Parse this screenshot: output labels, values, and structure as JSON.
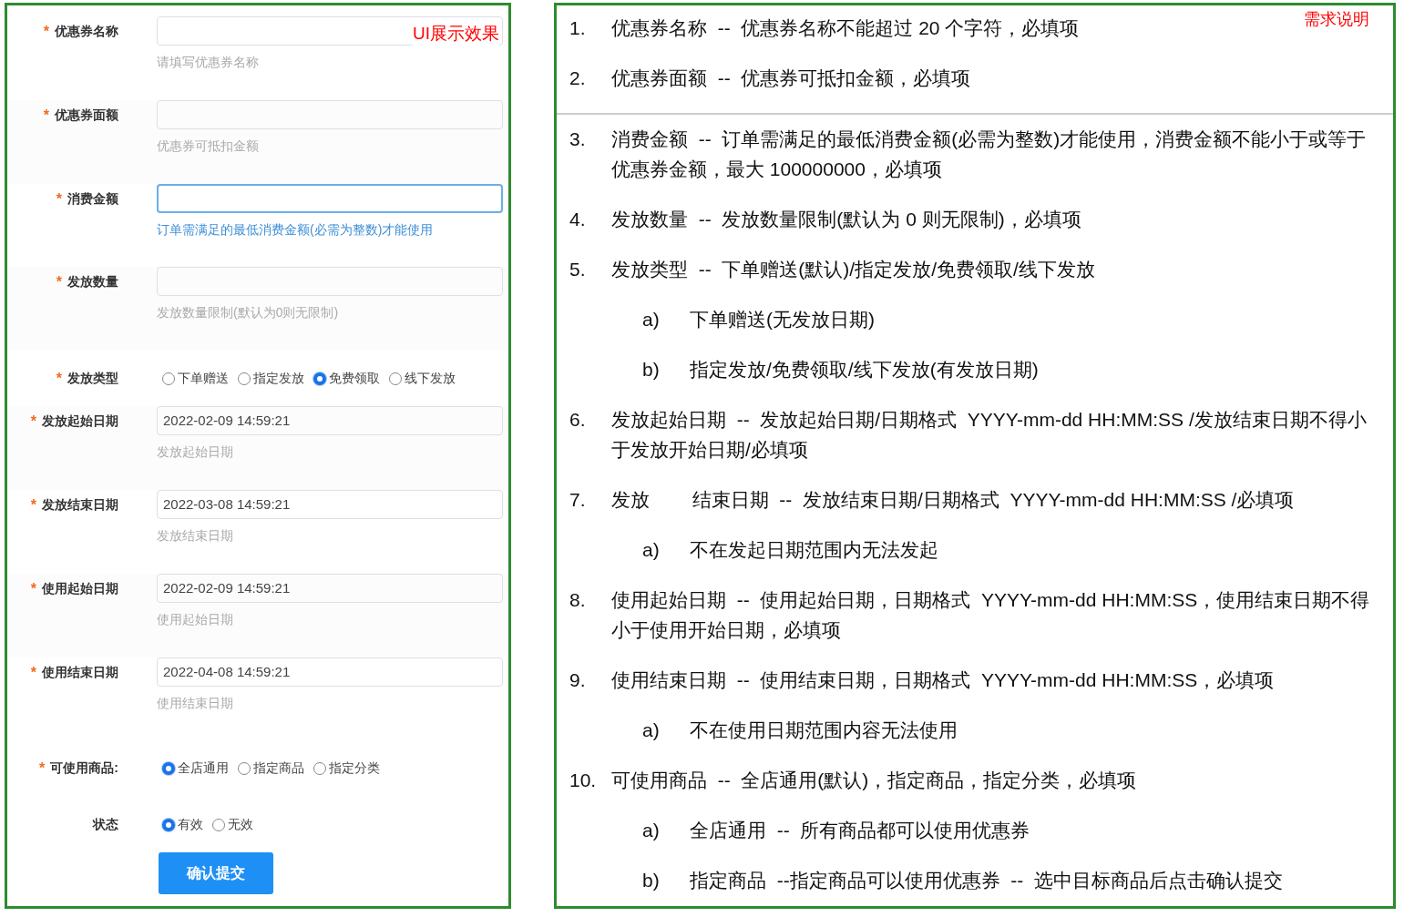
{
  "form_panel": {
    "badge": "UI展示效果",
    "fields": [
      {
        "kind": "input",
        "label": "优惠券名称",
        "required_mark": "*",
        "focused": false,
        "hint": "请填写优惠券名称"
      },
      {
        "kind": "input",
        "label": "优惠券面额",
        "required_mark": "*",
        "focused": false,
        "hint": "优惠券可抵扣金额"
      },
      {
        "kind": "input",
        "label": "消费金额",
        "required_mark": "*",
        "focused": true,
        "hint": "订单需满足的最低消费金额(必需为整数)才能使用"
      },
      {
        "kind": "input",
        "label": "发放数量",
        "required_mark": "*",
        "focused": false,
        "hint": "发放数量限制(默认为0则无限制)"
      },
      {
        "kind": "radio",
        "label": "发放类型",
        "required_mark": "*",
        "options": [
          {
            "label": "下单赠送",
            "selected": false
          },
          {
            "label": "指定发放",
            "selected": false
          },
          {
            "label": "免费领取",
            "selected": true
          },
          {
            "label": "线下发放",
            "selected": false
          }
        ]
      },
      {
        "kind": "input",
        "label": "发放起始日期",
        "required_mark": "*",
        "focused": false,
        "value": "2022-02-09 14:59:21",
        "hint": "发放起始日期"
      },
      {
        "kind": "input",
        "label": "发放结束日期",
        "required_mark": "*",
        "focused": false,
        "value": "2022-03-08 14:59:21",
        "hint": "发放结束日期"
      },
      {
        "kind": "input",
        "label": "使用起始日期",
        "required_mark": "*",
        "focused": false,
        "value": "2022-02-09 14:59:21",
        "hint": "使用起始日期"
      },
      {
        "kind": "input",
        "label": "使用结束日期",
        "required_mark": "*",
        "focused": false,
        "value": "2022-04-08 14:59:21",
        "hint": "使用结束日期"
      },
      {
        "kind": "radio",
        "label": "可使用商品:",
        "required_mark": "*",
        "options": [
          {
            "label": "全店通用",
            "selected": true
          },
          {
            "label": "指定商品",
            "selected": false
          },
          {
            "label": "指定分类",
            "selected": false
          }
        ]
      },
      {
        "kind": "radio",
        "label": "状态",
        "options": [
          {
            "label": "有效",
            "selected": true
          },
          {
            "label": "无效",
            "selected": false
          }
        ]
      }
    ],
    "submit_button": "确认提交"
  },
  "requirements_panel": {
    "badge": "需求说明",
    "sections": [
      [
        {
          "number": "1.",
          "text": "优惠券名称  --  优惠券名称不能超过 20 个字符，必填项"
        },
        {
          "number": "2.",
          "text": "优惠券面额  --  优惠券可抵扣金额，必填项"
        }
      ],
      [
        {
          "number": "3.",
          "text": "消费金额  --  订单需满足的最低消费金额(必需为整数)才能使用，消费金额不能小于或等于优惠券金额，最大 100000000，必填项"
        },
        {
          "number": "4.",
          "text": "发放数量  --  发放数量限制(默认为 0 则无限制)，必填项"
        },
        {
          "number": "5.",
          "text": "发放类型  --  下单赠送(默认)/指定发放/免费领取/线下发放",
          "children": [
            {
              "number": "a)",
              "text": "下单赠送(无发放日期)"
            },
            {
              "number": "b)",
              "text": "指定发放/免费领取/线下发放(有发放日期)"
            }
          ]
        },
        {
          "number": "6.",
          "text": "发放起始日期  --  发放起始日期/日期格式  YYYY-mm-dd HH:MM:SS /发放结束日期不得小于发放开始日期/必填项"
        },
        {
          "number": "7.",
          "text": "发放        结束日期  --  发放结束日期/日期格式  YYYY-mm-dd HH:MM:SS /必填项",
          "children": [
            {
              "number": "a)",
              "text": "不在发起日期范围内无法发起"
            }
          ]
        },
        {
          "number": "8.",
          "text": "使用起始日期  --  使用起始日期，日期格式  YYYY-mm-dd HH:MM:SS，使用结束日期不得小于使用开始日期，必填项"
        },
        {
          "number": "9.",
          "text": "使用结束日期  --  使用结束日期，日期格式  YYYY-mm-dd HH:MM:SS，必填项",
          "children": [
            {
              "number": "a)",
              "text": "不在使用日期范围内容无法使用"
            }
          ]
        },
        {
          "number": "10.",
          "text": "可使用商品  --  全店通用(默认)，指定商品，指定分类，必填项",
          "children": [
            {
              "number": "a)",
              "text": "全店通用  --  所有商品都可以使用优惠券"
            },
            {
              "number": "b)",
              "text": "指定商品  --指定商品可以使用优惠券  --  选中目标商品后点击确认提交"
            }
          ]
        }
      ]
    ]
  }
}
